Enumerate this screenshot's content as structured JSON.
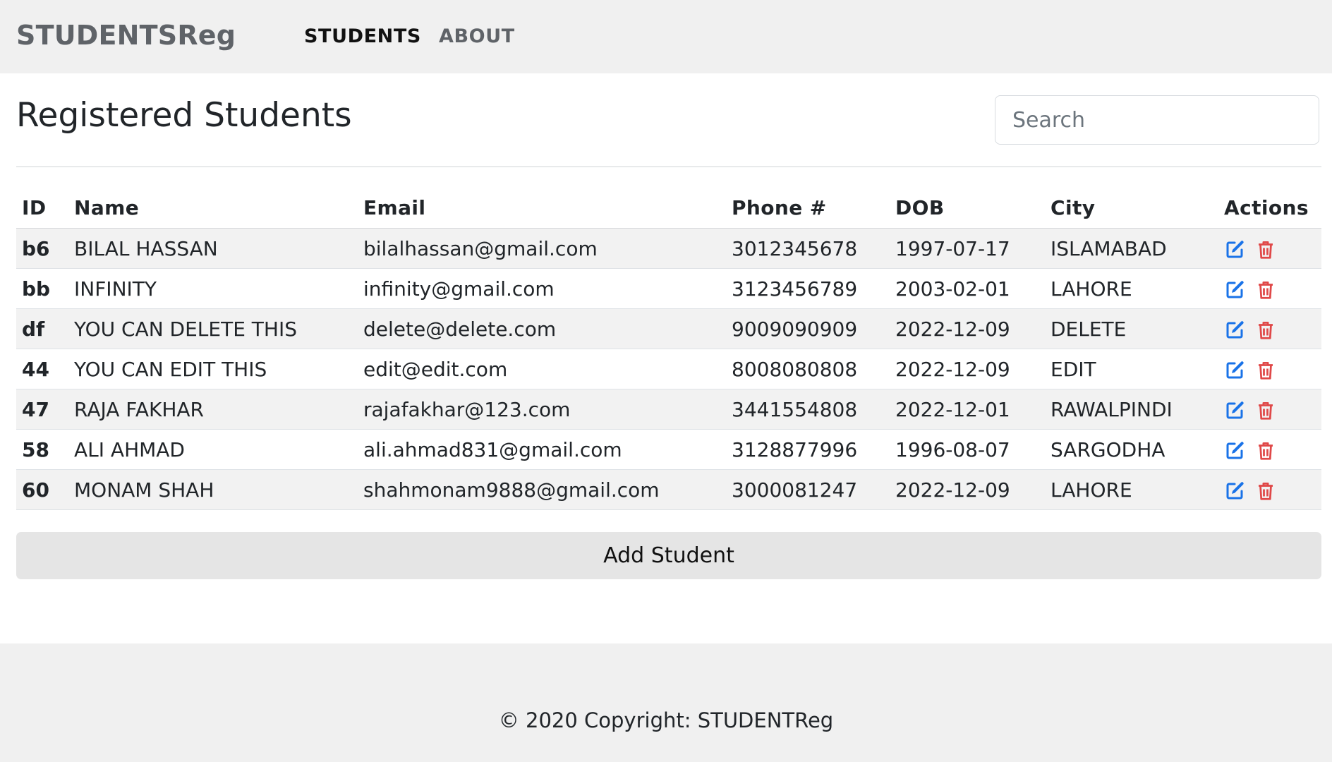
{
  "nav": {
    "brand": "STUDENTSReg",
    "links": [
      "STUDENTS",
      "ABOUT"
    ]
  },
  "main": {
    "title": "Registered Students",
    "search_placeholder": "Search",
    "add_button": "Add Student"
  },
  "table": {
    "headers": [
      "ID",
      "Name",
      "Email",
      "Phone #",
      "DOB",
      "City",
      "Actions"
    ],
    "rows": [
      [
        "b6",
        "BILAL HASSAN",
        "bilalhassan@gmail.com",
        "3012345678",
        "1997-07-17",
        "ISLAMABAD"
      ],
      [
        "bb",
        "INFINITY",
        "infinity@gmail.com",
        "3123456789",
        "2003-02-01",
        "LAHORE"
      ],
      [
        "df",
        "YOU CAN DELETE THIS",
        "delete@delete.com",
        "9009090909",
        "2022-12-09",
        "DELETE"
      ],
      [
        "44",
        "YOU CAN EDIT THIS",
        "edit@edit.com",
        "8008080808",
        "2022-12-09",
        "EDIT"
      ],
      [
        "47",
        "RAJA FAKHAR",
        "rajafakhar@123.com",
        "3441554808",
        "2022-12-01",
        "RAWALPINDI"
      ],
      [
        "58",
        "ALI AHMAD",
        "ali.ahmad831@gmail.com",
        "3128877996",
        "1996-08-07",
        "SARGODHA"
      ],
      [
        "60",
        "MONAM SHAH",
        "shahmonam9888@gmail.com",
        "3000081247",
        "2022-12-09",
        "LAHORE"
      ]
    ],
    "row_actions": [
      "edit-icon",
      "trash-icon"
    ]
  },
  "footer": {
    "text": "© 2020 Copyright: STUDENTReg"
  },
  "colors": {
    "edit_icon": "#1a73e8",
    "delete_icon": "#e04848",
    "navbar_bg": "#f0f0f0",
    "stripe_bg": "#f2f2f2"
  }
}
